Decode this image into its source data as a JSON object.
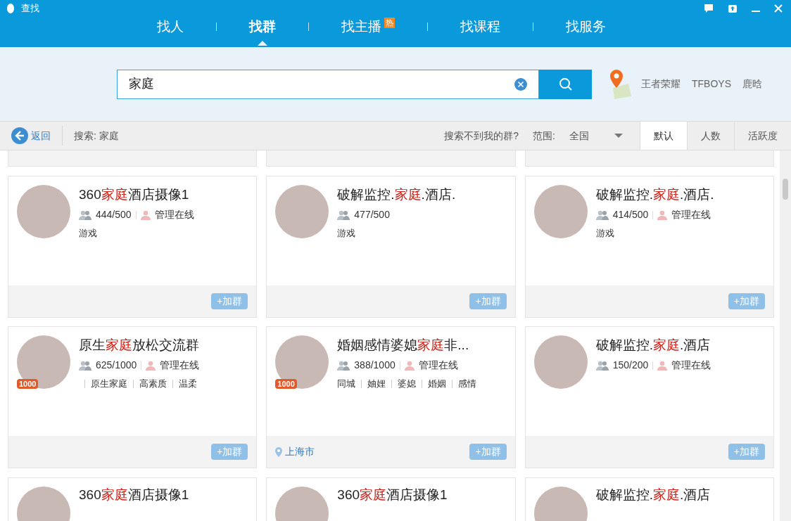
{
  "window": {
    "title": "查找"
  },
  "tabs": [
    {
      "label": "找人",
      "selected": false
    },
    {
      "label": "找群",
      "selected": true
    },
    {
      "label": "找主播",
      "selected": false,
      "hot": "热"
    },
    {
      "label": "找课程",
      "selected": false
    },
    {
      "label": "找服务",
      "selected": false
    }
  ],
  "search": {
    "value": "家庭"
  },
  "hot_keywords": [
    "王者荣耀",
    "TFBOYS",
    "鹿晗"
  ],
  "toolbar": {
    "back": "返回",
    "query": "搜索: 家庭",
    "help_link": "搜索不到我的群?",
    "scope_label": "范围:",
    "scope_value": "全国",
    "sort": [
      {
        "label": "默认",
        "selected": true
      },
      {
        "label": "人数",
        "selected": false
      },
      {
        "label": "活跃度",
        "selected": false
      }
    ]
  },
  "groups": [
    {
      "title": [
        {
          "text": "360",
          "highlight": false
        },
        {
          "text": "家庭",
          "highlight": true
        },
        {
          "text": "酒店摄像1",
          "highlight": false
        }
      ],
      "members": "444/500",
      "admin": "管理在线",
      "tags": [
        "游戏"
      ],
      "join": "+加群"
    },
    {
      "title": [
        {
          "text": "破解监控.",
          "highlight": false
        },
        {
          "text": "家庭",
          "highlight": true
        },
        {
          "text": ".酒店.",
          "highlight": false
        }
      ],
      "members": "477/500",
      "tags": [
        "游戏"
      ],
      "join": "+加群"
    },
    {
      "title": [
        {
          "text": "破解监控.",
          "highlight": false
        },
        {
          "text": "家庭",
          "highlight": true
        },
        {
          "text": ".酒店.",
          "highlight": false
        }
      ],
      "members": "414/500",
      "admin": "管理在线",
      "tags": [
        "游戏"
      ],
      "join": "+加群"
    },
    {
      "title": [
        {
          "text": "原生",
          "highlight": false
        },
        {
          "text": "家庭",
          "highlight": true
        },
        {
          "text": "放松交流群",
          "highlight": false
        }
      ],
      "members": "625/1000",
      "admin": "管理在线",
      "tags": [
        "原生家庭",
        "高素质",
        "温柔"
      ],
      "badge": "1000",
      "join": "+加群"
    },
    {
      "title": [
        {
          "text": "婚姻感情婆媳",
          "highlight": false
        },
        {
          "text": "家庭",
          "highlight": true
        },
        {
          "text": "非...",
          "highlight": false
        }
      ],
      "members": "388/1000",
      "admin": "管理在线",
      "tags": [
        "同城",
        "妯娌",
        "婆媳",
        "婚姻",
        "感情"
      ],
      "badge": "1000",
      "location": "上海市",
      "join": "+加群"
    },
    {
      "title": [
        {
          "text": "破解监控.",
          "highlight": false
        },
        {
          "text": "家庭",
          "highlight": true
        },
        {
          "text": ".酒店",
          "highlight": false
        }
      ],
      "members": "150/200",
      "admin": "管理在线",
      "join": "+加群"
    }
  ],
  "partial_groups": [
    {
      "title": [
        {
          "text": "360",
          "highlight": false
        },
        {
          "text": "家庭",
          "highlight": true
        },
        {
          "text": "酒店摄像1",
          "highlight": false
        }
      ]
    },
    {
      "title": [
        {
          "text": "360",
          "highlight": false
        },
        {
          "text": "家庭",
          "highlight": true
        },
        {
          "text": "酒店摄像1",
          "highlight": false
        }
      ]
    },
    {
      "title": [
        {
          "text": "破解监控.",
          "highlight": false
        },
        {
          "text": "家庭",
          "highlight": true
        },
        {
          "text": ".酒店",
          "highlight": false
        }
      ]
    }
  ]
}
